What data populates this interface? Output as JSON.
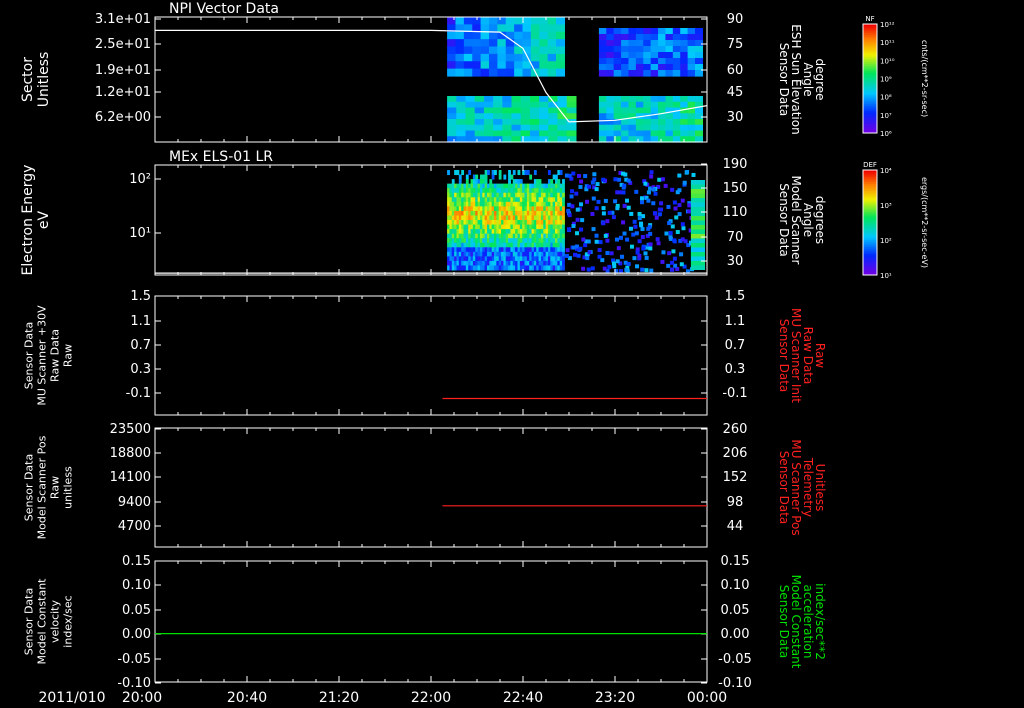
{
  "figure": {
    "date_label": "2011/010",
    "time_ticks": [
      "20:00",
      "20:40",
      "21:20",
      "22:00",
      "22:40",
      "23:20",
      "00:00"
    ]
  },
  "colors": {
    "background": "#000000",
    "frame": "#ffffff",
    "red_trace": "#ff2020",
    "green_trace": "#00e000"
  },
  "chart_data": [
    {
      "type": "heatmap",
      "title": "NPI Vector Data",
      "ylabel_left": [
        "Sector",
        "Unitless"
      ],
      "ylabel_right": [
        "Sensor Data",
        "ESH Sun Elevation",
        "Angle",
        "degree"
      ],
      "yticks_left": [
        "3.1e+01",
        "2.5e+01",
        "1.9e+01",
        "1.2e+01",
        "6.2e+00"
      ],
      "yticks_right": [
        "90",
        "75",
        "60",
        "45",
        "30"
      ],
      "colorbar": {
        "label": "NF",
        "unit": "cnts/(cm**2-sr-sec)",
        "ticks": [
          "10¹²",
          "10¹¹",
          "10¹⁰",
          "10⁹",
          "10⁸",
          "10⁷",
          "10⁶"
        ]
      },
      "overlay_line": {
        "name": "ESH Sun Elevation Angle",
        "x": [
          "20:00",
          "21:00",
          "22:00",
          "22:30",
          "22:40",
          "22:50",
          "23:00",
          "23:20",
          "23:40",
          "00:00"
        ],
        "y": [
          83,
          83,
          83,
          82,
          72,
          45,
          27,
          28,
          32,
          37
        ]
      }
    },
    {
      "type": "heatmap",
      "title": "MEx ELS-01 LR",
      "ylabel_left": [
        "Electron Energy",
        "eV"
      ],
      "ylabel_right": [
        "Sensor Data",
        "Model Scanner",
        "Angle",
        "degrees"
      ],
      "yticks_left": [
        "10²",
        "10¹"
      ],
      "yticks_right": [
        "190",
        "150",
        "110",
        "70",
        "30"
      ],
      "colorbar": {
        "label": "DEF",
        "unit": "ergs/(cm**2-sr-sec-eV)",
        "ticks": [
          "10⁴",
          "10³",
          "10²",
          "10¹"
        ]
      },
      "overlay_line": {
        "name": "Model Scanner Angle",
        "x": [
          "20:00",
          "00:00"
        ],
        "y": [
          10,
          10
        ]
      }
    },
    {
      "type": "line",
      "ylabel_left": [
        "Sensor Data",
        "MU Scanner +30V",
        "Raw Data",
        "Raw"
      ],
      "ylabel_right": [
        "Sensor Data",
        "MU Scanner Init",
        "Raw Data",
        "Raw"
      ],
      "yticks_left": [
        "1.5",
        "1.1",
        "0.7",
        "0.3",
        "-0.1"
      ],
      "yticks_right": [
        "1.5",
        "1.1",
        "0.7",
        "0.3",
        "-0.1"
      ],
      "ylim": [
        -0.3,
        1.5
      ],
      "series": [
        {
          "x": [
            "22:05",
            "00:00"
          ],
          "y": [
            -0.05,
            -0.05
          ]
        }
      ]
    },
    {
      "type": "line",
      "ylabel_left": [
        "Sensor Data",
        "Model Scanner Pos",
        "Raw",
        "unitless"
      ],
      "ylabel_right": [
        "Sensor Data",
        "MU Scanner Pos",
        "Telemetry",
        "Unitless"
      ],
      "yticks_left": [
        "23500",
        "18800",
        "14100",
        "9400",
        "4700"
      ],
      "yticks_right": [
        "260",
        "206",
        "152",
        "98",
        "44"
      ],
      "ylim": [
        0,
        23500
      ],
      "series": [
        {
          "x": [
            "22:05",
            "00:00"
          ],
          "y": [
            89,
            89
          ]
        }
      ]
    },
    {
      "type": "line",
      "ylabel_left": [
        "Sensor Data",
        "Model Constant",
        "velocity",
        "index/sec"
      ],
      "ylabel_right": [
        "Sensor Data",
        "Model Constant",
        "acceleration",
        "index/sec**2"
      ],
      "yticks_left": [
        "0.15",
        "0.10",
        "0.05",
        "0.00",
        "-0.05",
        "-0.10"
      ],
      "yticks_right": [
        "0.15",
        "0.10",
        "0.05",
        "0.00",
        "-0.05",
        "-0.10"
      ],
      "ylim": [
        -0.1,
        0.15
      ],
      "series": [
        {
          "x": [
            "20:00",
            "00:00"
          ],
          "y": [
            0.0,
            0.0
          ]
        }
      ]
    }
  ]
}
